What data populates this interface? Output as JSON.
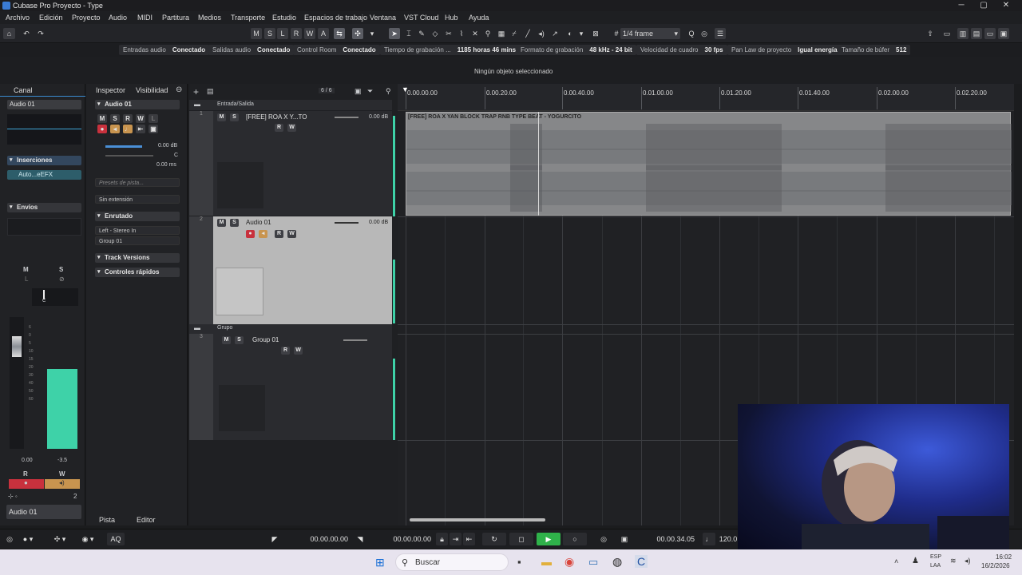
{
  "titlebar": {
    "title": "Cubase Pro Proyecto - Type",
    "minimize": "─",
    "maximize": "▢",
    "close": "✕"
  },
  "menu": [
    "Archivo",
    "Edición",
    "Proyecto",
    "Audio",
    "MIDI",
    "Partitura",
    "Medios",
    "Transporte",
    "Estudio",
    "Espacios de trabajo",
    "Ventana",
    "VST Cloud",
    "Hub",
    "Ayuda"
  ],
  "toolbar": {
    "mode_buttons": [
      "M",
      "S",
      "L",
      "R",
      "W",
      "A"
    ],
    "quantize": "1/4 frame"
  },
  "status": [
    {
      "label": "Entradas audio",
      "value": "Conectado"
    },
    {
      "label": "Salidas audio",
      "value": "Conectado"
    },
    {
      "label": "Control Room",
      "value": "Conectado"
    },
    {
      "label": "Tiempo de grabación ...",
      "value": "1185 horas 46 mins"
    },
    {
      "label": "Formato de grabación",
      "value": "48 kHz - 24 bit"
    },
    {
      "label": "Velocidad de cuadro",
      "value": "30 fps"
    },
    {
      "label": "Pan Law de proyecto",
      "value": "Igual energía"
    },
    {
      "label": "Tamaño de búfer",
      "value": "512"
    }
  ],
  "info": {
    "message": "Ningún objeto seleccionado"
  },
  "channel": {
    "tab": "Canal",
    "name": "Audio 01",
    "inserts_label": "Inserciones",
    "insert_slot": "Auto...eEFX",
    "sends_label": "Envíos",
    "m": "M",
    "s": "S",
    "l": "L",
    "pan": "C",
    "scale": [
      "6",
      "0",
      "5",
      "10",
      "15",
      "20",
      "30",
      "40",
      "50",
      "60"
    ],
    "volume": "0.00",
    "peak": "-3.5",
    "r": "R",
    "w": "W",
    "count": "2",
    "footer_name": "Audio 01"
  },
  "inspector": {
    "tab_inspector": "Inspector",
    "tab_visibility": "Visibilidad",
    "track_name": "Audio 01",
    "buttons": [
      "M",
      "S",
      "R",
      "W",
      "L"
    ],
    "volume": "0.00 dB",
    "pan": "C",
    "delay": "0.00 ms",
    "presets_placeholder": "Presets de pista...",
    "extension": "Sin extensión",
    "routing_label": "Enrutado",
    "input": "Left - Stereo In",
    "output": "Group 01",
    "versions_label": "Track Versions",
    "quick_label": "Controles rápidos",
    "bottom_tab_track": "Pista",
    "bottom_tab_editor": "Editor"
  },
  "tracklist": {
    "counter": "6 / 6",
    "folder1": "Entrada/Salida",
    "track1": {
      "num": "1",
      "name": "[FREE] ROA X Y...TO",
      "vol": "0.00 dB"
    },
    "track2": {
      "num": "2",
      "name": "Audio 01",
      "vol": "0.00 dB"
    },
    "folder2": "Grupo",
    "track3": {
      "num": "3",
      "name": "Group 01"
    },
    "btn_m": "M",
    "btn_s": "S",
    "btn_r": "R",
    "btn_w": "W"
  },
  "ruler": [
    "0.00.00.00",
    "0.00.20.00",
    "0.00.40.00",
    "0.01.00.00",
    "0.01.20.00",
    "0.01.40.00",
    "0.02.00.00",
    "0.02.20.00"
  ],
  "clip": {
    "name": "[FREE] ROA X YAN BLOCK TRAP RNB TYPE BEAT - YOGURCITO"
  },
  "transport": {
    "left_locator": "00.00.00.00",
    "right_locator": "00.00.00.00",
    "position": "00.00.34.05",
    "tempo": "120.0",
    "aq": "AQ"
  },
  "taskbar": {
    "search": "Buscar",
    "lang1": "ESP",
    "lang2": "LAA",
    "time": "16:02",
    "date": "16/2/2026"
  },
  "colors": {
    "accent": "#3ed2a8",
    "record": "#c8313d",
    "monitor": "#c8944f",
    "clip": "#868789"
  }
}
